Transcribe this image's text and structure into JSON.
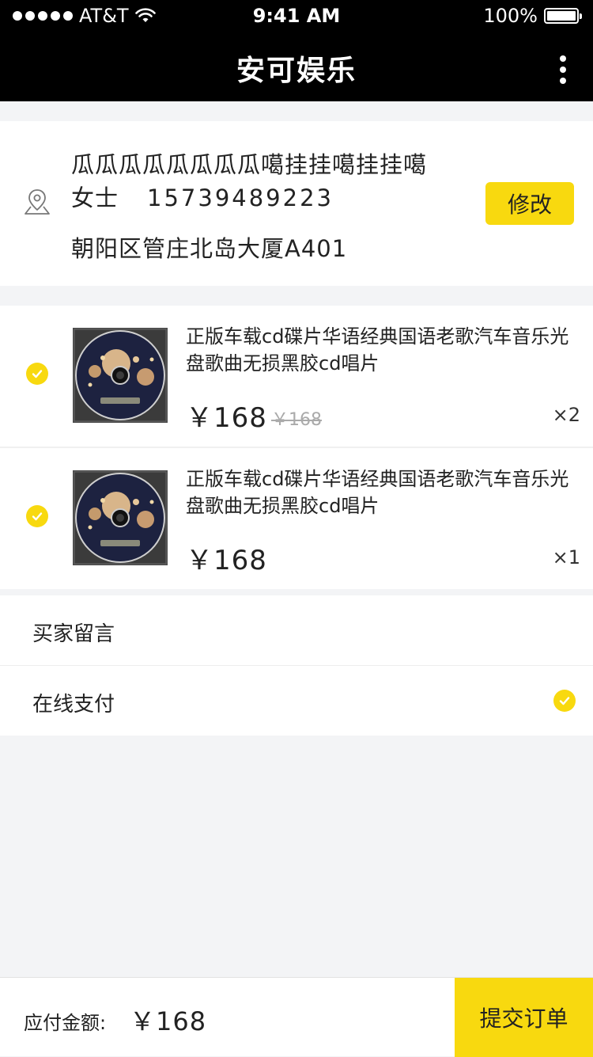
{
  "status_bar": {
    "carrier": "AT&T",
    "time": "9:41 AM",
    "battery": "100%"
  },
  "nav": {
    "title": "安可娱乐",
    "more_icon": "more-vertical-icon"
  },
  "address": {
    "name_line": "瓜瓜瓜瓜瓜瓜瓜瓜噶挂挂噶挂挂噶",
    "title": "女士",
    "phone": "15739489223",
    "street": "朝阳区管庄北岛大厦A401",
    "edit_label": "修改",
    "icon": "location-pin-icon"
  },
  "products": [
    {
      "title": "正版车载cd碟片华语经典国语老歌汽车音乐光盘歌曲无损黑胶cd唱片",
      "price": "￥168",
      "original_price": "￥168",
      "quantity": "×2",
      "checked": true
    },
    {
      "title": "正版车载cd碟片华语经典国语老歌汽车音乐光盘歌曲无损黑胶cd唱片",
      "price": "￥168",
      "original_price": "",
      "quantity": "×1",
      "checked": true
    }
  ],
  "buyer_message": {
    "label": "买家留言"
  },
  "payment": {
    "label": "在线支付",
    "selected": true
  },
  "footer": {
    "total_label": "应付金额:",
    "total_value": "￥168",
    "submit_label": "提交订单"
  },
  "colors": {
    "accent": "#f8d90f",
    "bar": "#000000",
    "background": "#f3f4f6"
  }
}
